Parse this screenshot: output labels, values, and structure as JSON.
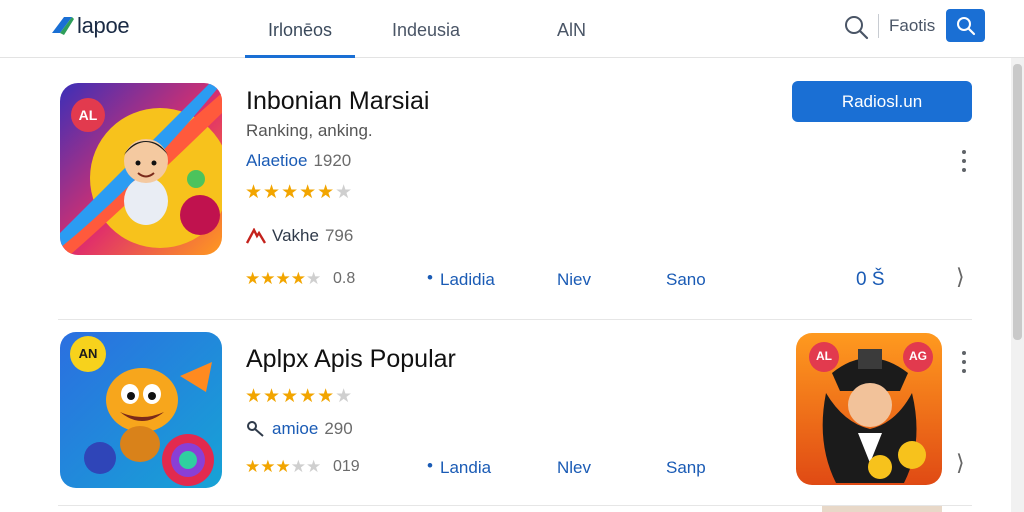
{
  "header": {
    "logo_text": "lapoe",
    "tabs": [
      {
        "label": "Irlonēos",
        "active": true
      },
      {
        "label": "Indeusia",
        "active": false
      },
      {
        "label": "AlN",
        "active": false
      }
    ],
    "link_label": "Faotis",
    "search_icon": "search-icon",
    "user_icon": "user-search-icon",
    "accent_color": "#1a6fd4"
  },
  "apps": [
    {
      "title": "Inbonian Marsiai",
      "subtitle": "Ranking, anking.",
      "developer": "Alaetioe",
      "developer_count": "1920",
      "rating_stars": 4.5,
      "publisher_icon": "publisher-logo-icon",
      "publisher": "Vakhe",
      "publisher_count": "796",
      "install_label": "Radiosl.un",
      "bottom": {
        "small_rating_stars": 3.5,
        "small_count": "0.8",
        "links": [
          "Ladidia",
          "Niev",
          "Sano",
          "0 Š"
        ]
      }
    },
    {
      "title": "Aplpx Apis Popular",
      "rating_stars": 4.5,
      "publisher_icon": "link-icon",
      "publisher": "amioe",
      "publisher_count": "290",
      "bottom": {
        "small_rating_stars": 3,
        "small_count": "019",
        "links": [
          "Landia",
          "Nlev",
          "Sanp"
        ]
      }
    }
  ],
  "badges": {
    "left_app_1": "AL",
    "left_app_2": "AN",
    "right_app_a": "AL",
    "right_app_b": "AG"
  }
}
